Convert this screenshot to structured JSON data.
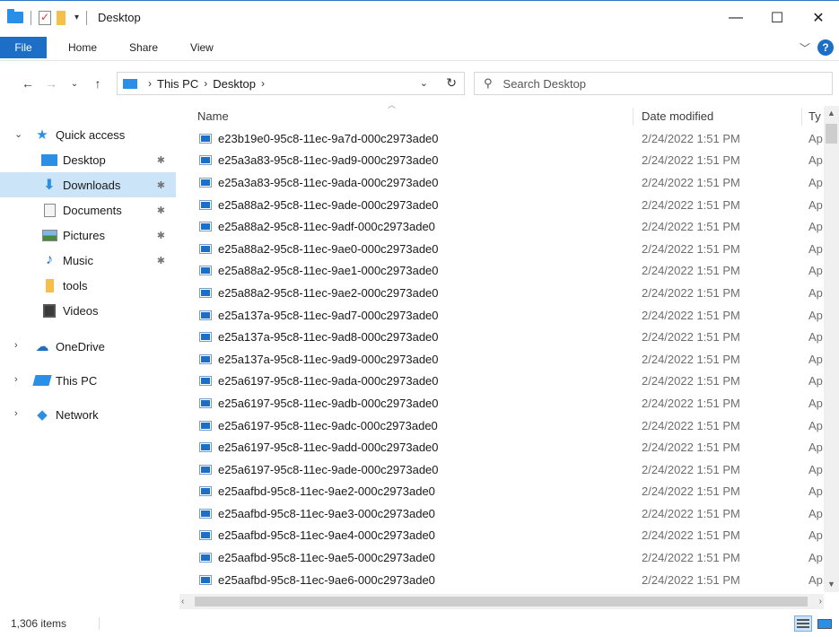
{
  "window": {
    "title": "Desktop",
    "minimize": "—",
    "maximize": "☐",
    "close": "✕"
  },
  "ribbon": {
    "tabs": [
      "File",
      "Home",
      "Share",
      "View"
    ],
    "expand_icon": "chevron-down-icon",
    "help_label": "?"
  },
  "address": {
    "path": [
      "This PC",
      "Desktop"
    ],
    "separator": "›"
  },
  "search": {
    "placeholder": "Search Desktop"
  },
  "nav": {
    "quick_access": "Quick access",
    "pinned": [
      {
        "label": "Desktop",
        "icon": "desktop-icon",
        "pinned": true
      },
      {
        "label": "Downloads",
        "icon": "downloads-icon",
        "pinned": true,
        "selected": true
      },
      {
        "label": "Documents",
        "icon": "documents-icon",
        "pinned": true
      },
      {
        "label": "Pictures",
        "icon": "pictures-icon",
        "pinned": true
      },
      {
        "label": "Music",
        "icon": "music-icon",
        "pinned": true
      },
      {
        "label": "tools",
        "icon": "folder-icon",
        "pinned": false
      },
      {
        "label": "Videos",
        "icon": "videos-icon",
        "pinned": false
      }
    ],
    "roots": [
      {
        "label": "OneDrive",
        "icon": "onedrive-icon"
      },
      {
        "label": "This PC",
        "icon": "this-pc-icon"
      },
      {
        "label": "Network",
        "icon": "network-icon"
      }
    ]
  },
  "columns": {
    "name": "Name",
    "date": "Date modified",
    "type": "Ty"
  },
  "files": [
    {
      "name": "e23b19e0-95c8-11ec-9a7d-000c2973ade0",
      "date": "2/24/2022 1:51 PM",
      "type": "Ap"
    },
    {
      "name": "e25a3a83-95c8-11ec-9ad9-000c2973ade0",
      "date": "2/24/2022 1:51 PM",
      "type": "Ap"
    },
    {
      "name": "e25a3a83-95c8-11ec-9ada-000c2973ade0",
      "date": "2/24/2022 1:51 PM",
      "type": "Ap"
    },
    {
      "name": "e25a88a2-95c8-11ec-9ade-000c2973ade0",
      "date": "2/24/2022 1:51 PM",
      "type": "Ap"
    },
    {
      "name": "e25a88a2-95c8-11ec-9adf-000c2973ade0",
      "date": "2/24/2022 1:51 PM",
      "type": "Ap"
    },
    {
      "name": "e25a88a2-95c8-11ec-9ae0-000c2973ade0",
      "date": "2/24/2022 1:51 PM",
      "type": "Ap"
    },
    {
      "name": "e25a88a2-95c8-11ec-9ae1-000c2973ade0",
      "date": "2/24/2022 1:51 PM",
      "type": "Ap"
    },
    {
      "name": "e25a88a2-95c8-11ec-9ae2-000c2973ade0",
      "date": "2/24/2022 1:51 PM",
      "type": "Ap"
    },
    {
      "name": "e25a137a-95c8-11ec-9ad7-000c2973ade0",
      "date": "2/24/2022 1:51 PM",
      "type": "Ap"
    },
    {
      "name": "e25a137a-95c8-11ec-9ad8-000c2973ade0",
      "date": "2/24/2022 1:51 PM",
      "type": "Ap"
    },
    {
      "name": "e25a137a-95c8-11ec-9ad9-000c2973ade0",
      "date": "2/24/2022 1:51 PM",
      "type": "Ap"
    },
    {
      "name": "e25a6197-95c8-11ec-9ada-000c2973ade0",
      "date": "2/24/2022 1:51 PM",
      "type": "Ap"
    },
    {
      "name": "e25a6197-95c8-11ec-9adb-000c2973ade0",
      "date": "2/24/2022 1:51 PM",
      "type": "Ap"
    },
    {
      "name": "e25a6197-95c8-11ec-9adc-000c2973ade0",
      "date": "2/24/2022 1:51 PM",
      "type": "Ap"
    },
    {
      "name": "e25a6197-95c8-11ec-9add-000c2973ade0",
      "date": "2/24/2022 1:51 PM",
      "type": "Ap"
    },
    {
      "name": "e25a6197-95c8-11ec-9ade-000c2973ade0",
      "date": "2/24/2022 1:51 PM",
      "type": "Ap"
    },
    {
      "name": "e25aafbd-95c8-11ec-9ae2-000c2973ade0",
      "date": "2/24/2022 1:51 PM",
      "type": "Ap"
    },
    {
      "name": "e25aafbd-95c8-11ec-9ae3-000c2973ade0",
      "date": "2/24/2022 1:51 PM",
      "type": "Ap"
    },
    {
      "name": "e25aafbd-95c8-11ec-9ae4-000c2973ade0",
      "date": "2/24/2022 1:51 PM",
      "type": "Ap"
    },
    {
      "name": "e25aafbd-95c8-11ec-9ae5-000c2973ade0",
      "date": "2/24/2022 1:51 PM",
      "type": "Ap"
    },
    {
      "name": "e25aafbd-95c8-11ec-9ae6-000c2973ade0",
      "date": "2/24/2022 1:51 PM",
      "type": "Ap"
    }
  ],
  "status": {
    "item_count": "1,306 items"
  },
  "colors": {
    "accent": "#1c6ec7",
    "selection": "#cce4f7",
    "folder_blue": "#2b8fe6",
    "folder_yellow": "#f5c04a"
  }
}
